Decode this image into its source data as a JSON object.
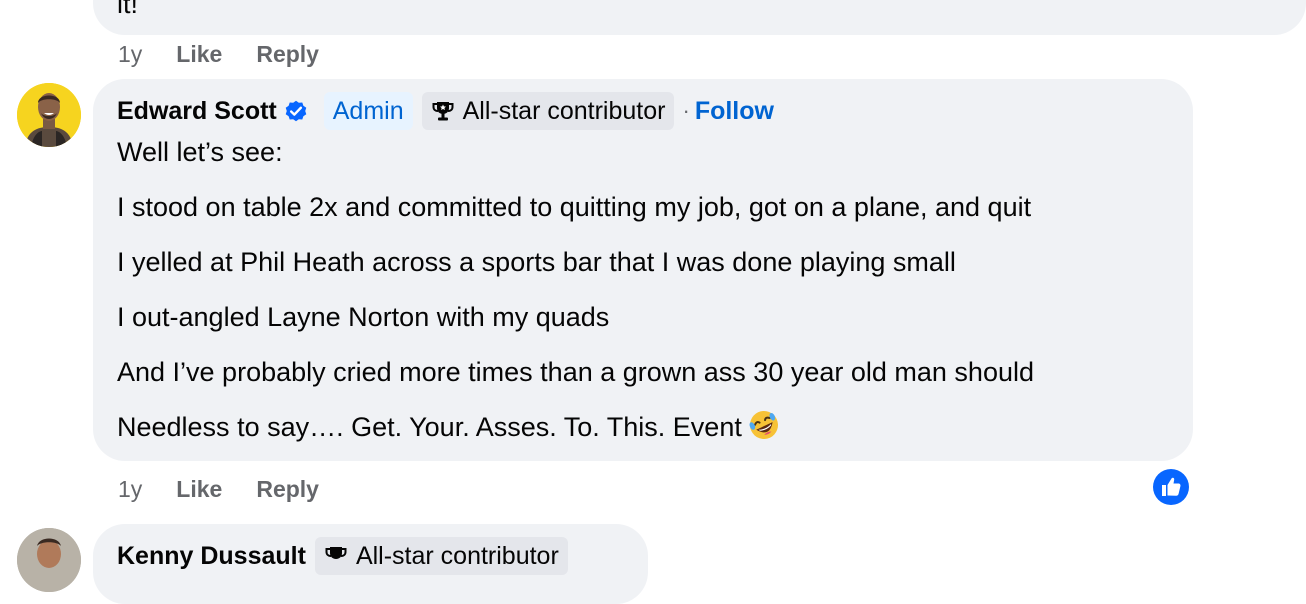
{
  "previous_comment": {
    "text_fragment": "it!",
    "actions": {
      "time": "1y",
      "like": "Like",
      "reply": "Reply"
    }
  },
  "comment": {
    "author": "Edward Scott",
    "verified": true,
    "badges": {
      "admin": "Admin",
      "allstar": "All-star contributor"
    },
    "separator": "·",
    "follow": "Follow",
    "lines": [
      "Well let’s see:",
      "I stood on table 2x and committed to quitting my job, got on a plane, and quit",
      "I yelled at Phil Heath across a sports bar that I was done playing small",
      "I out-angled Layne Norton with my quads",
      "And I’ve probably cried more times than a grown ass 30 year old man should",
      "Needless to say…. Get. Your. Asses. To. This. Event"
    ],
    "emoji": "rolling-on-floor-laughing",
    "actions": {
      "time": "1y",
      "like": "Like",
      "reply": "Reply"
    },
    "reaction": "like-icon"
  },
  "next_comment": {
    "author": "Kenny Dussault",
    "badge": "All-star contributor"
  },
  "colors": {
    "bubble": "#f0f2f5",
    "link_blue": "#0064d1",
    "verified_blue": "#0866ff",
    "muted": "#65676b",
    "admin_bg": "#e7f3ff",
    "allstar_bg": "#e4e6eb"
  }
}
